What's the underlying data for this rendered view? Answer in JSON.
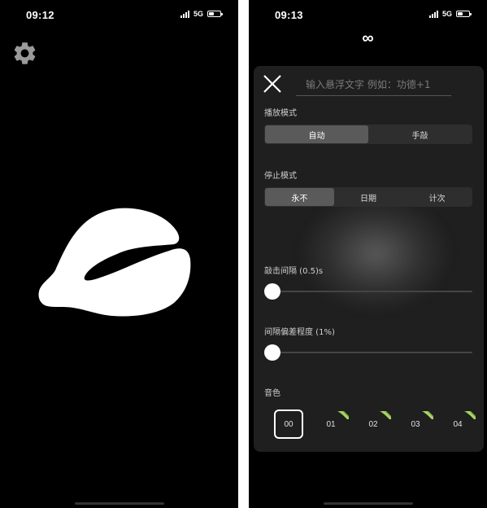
{
  "left_screen": {
    "status": {
      "time": "09:12",
      "network": "5G"
    }
  },
  "right_screen": {
    "status": {
      "time": "09:13",
      "network": "5G"
    },
    "infinity_symbol": "∞",
    "panel": {
      "input_placeholder": "输入悬浮文字 例如：功德+1",
      "play_mode": {
        "label": "播放模式",
        "options": [
          "自动",
          "手敲"
        ],
        "selected": "自动"
      },
      "stop_mode": {
        "label": "停止模式",
        "options": [
          "永不",
          "日期",
          "计次"
        ],
        "selected": "永不"
      },
      "tap_interval": {
        "label": "敲击间隔 (0.5)s",
        "value_seconds": 0.5
      },
      "interval_deviation": {
        "label": "间隔偏差程度 (1%)",
        "value_percent": 1
      },
      "tone": {
        "label": "音色",
        "options": [
          "00",
          "01",
          "02",
          "03",
          "04"
        ],
        "selected": "00"
      }
    }
  },
  "colors": {
    "background": "#000000",
    "panel": "#1f1f1f",
    "segment_active": "#5a5a5a",
    "vip_badge": "#7fae3a"
  }
}
